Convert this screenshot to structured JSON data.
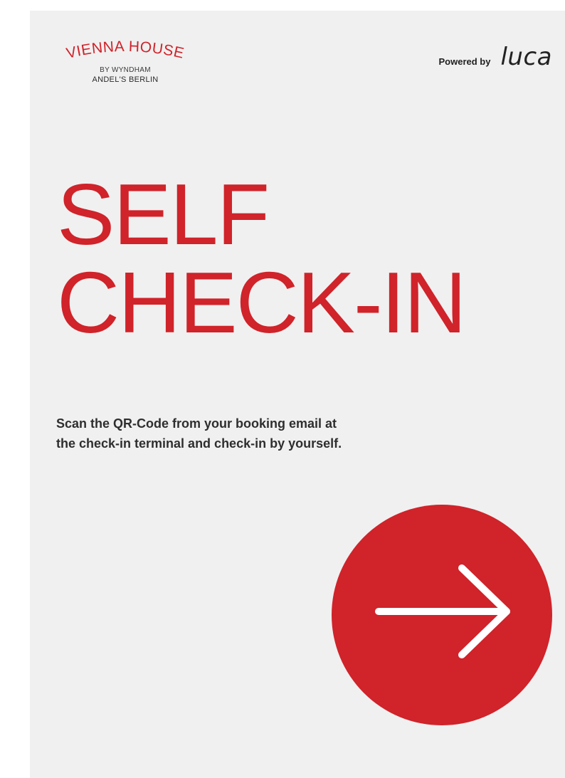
{
  "brand": {
    "name": "VIENNA HOUSE",
    "line2": "BY WYNDHAM",
    "line3": "ANDEL'S BERLIN"
  },
  "powered": {
    "label": "Powered by",
    "logo": "luca"
  },
  "headline": {
    "line1": "SELF",
    "line2": "CHECK-IN"
  },
  "description": {
    "line1": "Scan the QR-Code from your booking email at",
    "line2": "the check-in terminal and check-in by yourself."
  },
  "icons": {
    "arrow": "arrow-right-icon"
  },
  "colors": {
    "accent": "#d0232a",
    "background": "#f0f0f0",
    "text": "#2e2e2e"
  }
}
